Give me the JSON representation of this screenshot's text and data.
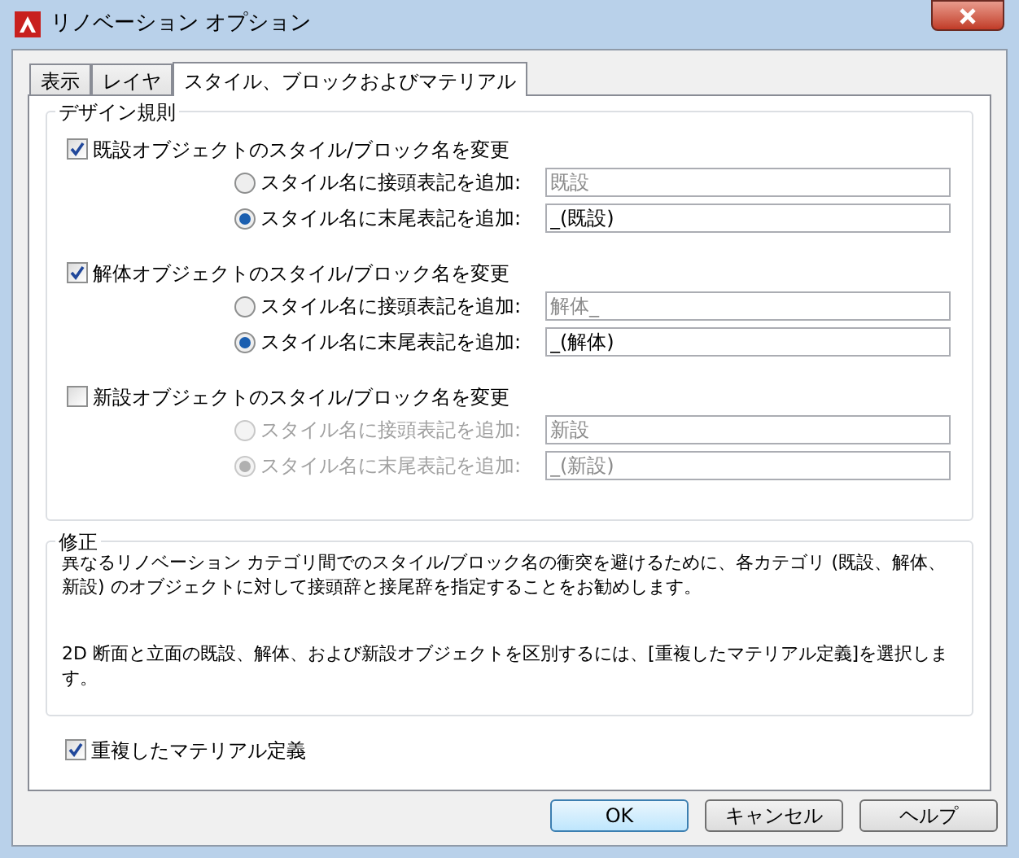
{
  "window": {
    "title": "リノベーション オプション"
  },
  "tabs": [
    {
      "label": "表示",
      "selected": false
    },
    {
      "label": "レイヤ",
      "selected": false
    },
    {
      "label": "スタイル、ブロックおよびマテリアル",
      "selected": true
    }
  ],
  "design_rules": {
    "title": "デザイン規則",
    "groups": [
      {
        "label": "既設オブジェクトのスタイル/ブロック名を変更",
        "checked": true,
        "options": [
          {
            "label": "スタイル名に接頭表記を追加:",
            "selected": false,
            "disabled": false,
            "value": "既設",
            "field_disabled": true
          },
          {
            "label": "スタイル名に末尾表記を追加:",
            "selected": true,
            "disabled": false,
            "value": "_(既設)",
            "field_disabled": false
          }
        ]
      },
      {
        "label": "解体オブジェクトのスタイル/ブロック名を変更",
        "checked": true,
        "options": [
          {
            "label": "スタイル名に接頭表記を追加:",
            "selected": false,
            "disabled": false,
            "value": "解体_",
            "field_disabled": true
          },
          {
            "label": "スタイル名に末尾表記を追加:",
            "selected": true,
            "disabled": false,
            "value": "_(解体)",
            "field_disabled": false
          }
        ]
      },
      {
        "label": "新設オブジェクトのスタイル/ブロック名を変更",
        "checked": false,
        "options": [
          {
            "label": "スタイル名に接頭表記を追加:",
            "selected": false,
            "disabled": true,
            "value": "新設",
            "field_disabled": true
          },
          {
            "label": "スタイル名に末尾表記を追加:",
            "selected": true,
            "disabled": true,
            "value": "_(新設)",
            "field_disabled": true
          }
        ]
      }
    ]
  },
  "note": {
    "title": "修正",
    "paragraphs": [
      "異なるリノベーション カテゴリ間でのスタイル/ブロック名の衝突を避けるために、各カテゴリ (既設、解体、新設) のオブジェクトに対して接頭辞と接尾辞を指定することをお勧めします。",
      "2D 断面と立面の既設、解体、および新設オブジェクトを区別するには、[重複したマテリアル定義]を選択します。"
    ]
  },
  "duplicate_material": {
    "label": "重複したマテリアル定義",
    "checked": true
  },
  "buttons": [
    {
      "label": "OK",
      "default": true
    },
    {
      "label": "キャンセル",
      "default": false
    },
    {
      "label": "ヘルプ",
      "default": false
    }
  ]
}
